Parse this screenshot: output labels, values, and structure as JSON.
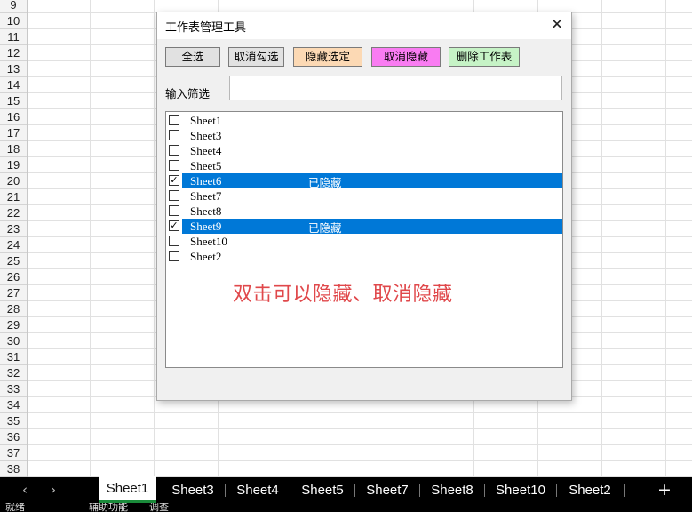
{
  "spreadsheet": {
    "rows": [
      "9",
      "10",
      "11",
      "12",
      "13",
      "14",
      "15",
      "16",
      "17",
      "18",
      "19",
      "20",
      "21",
      "22",
      "23",
      "24",
      "25",
      "26",
      "27",
      "28",
      "29",
      "30",
      "31",
      "32",
      "33",
      "34",
      "35",
      "36",
      "37",
      "38"
    ]
  },
  "dialog": {
    "title": "工作表管理工具",
    "close_label": "✕",
    "buttons": {
      "select_all": "全选",
      "unselect": "取消勾选",
      "hide_selected": "隐藏选定",
      "unhide": "取消隐藏",
      "delete": "删除工作表"
    },
    "button_colors": {
      "hide_selected": "#fcd9b4",
      "unhide": "#f97cf2",
      "delete": "#c6f3c6"
    },
    "filter": {
      "label": "输入筛选",
      "value": "",
      "placeholder": ""
    },
    "sheets": [
      {
        "name": "Sheet1",
        "checked": false,
        "status": "",
        "selected": false
      },
      {
        "name": "Sheet3",
        "checked": false,
        "status": "",
        "selected": false
      },
      {
        "name": "Sheet4",
        "checked": false,
        "status": "",
        "selected": false
      },
      {
        "name": "Sheet5",
        "checked": false,
        "status": "",
        "selected": false
      },
      {
        "name": "Sheet6",
        "checked": true,
        "status": "已隐藏",
        "selected": true
      },
      {
        "name": "Sheet7",
        "checked": false,
        "status": "",
        "selected": false
      },
      {
        "name": "Sheet8",
        "checked": false,
        "status": "",
        "selected": false
      },
      {
        "name": "Sheet9",
        "checked": true,
        "status": "已隐藏",
        "selected": true
      },
      {
        "name": "Sheet10",
        "checked": false,
        "status": "",
        "selected": false
      },
      {
        "name": "Sheet2",
        "checked": false,
        "status": "",
        "selected": false
      }
    ],
    "annotation": "双击可以隐藏、取消隐藏"
  },
  "tabbar": {
    "prev_icon": "‹",
    "next_icon": "›",
    "tabs": [
      "Sheet1",
      "Sheet3",
      "Sheet4",
      "Sheet5",
      "Sheet7",
      "Sheet8",
      "Sheet10",
      "Sheet2"
    ],
    "active_tab": "Sheet1",
    "add_label": "+"
  },
  "statusbar": {
    "items": [
      "就绪",
      "辅助功能",
      "调查"
    ]
  },
  "colors": {
    "selection": "#0078d7",
    "annotation": "#e0484b",
    "active_tab_underline": "#1a8a3a"
  }
}
